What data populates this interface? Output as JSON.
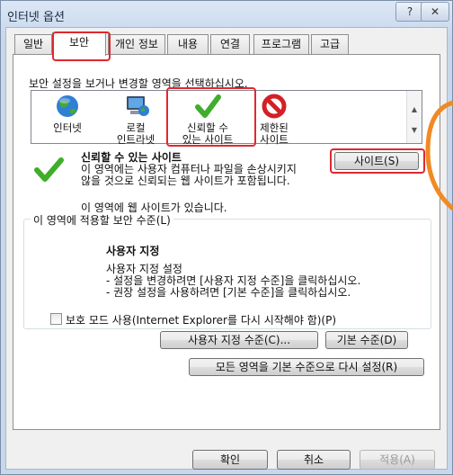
{
  "window": {
    "title": "인터넷 옵션",
    "help_label": "?",
    "close_label": "✕"
  },
  "tabs": [
    "일반",
    "보안",
    "개인 정보",
    "내용",
    "연결",
    "프로그램",
    "고급"
  ],
  "zones": {
    "instruction": "보안 설정을 보거나 변경할 영역을 선택하십시오.",
    "items": [
      {
        "line1": "인터넷",
        "line2": "",
        "icon": "globe-icon"
      },
      {
        "line1": "로컬",
        "line2": "인트라넷",
        "icon": "intranet-icon"
      },
      {
        "line1": "신뢰할 수",
        "line2": "있는 사이트",
        "icon": "check-icon"
      },
      {
        "line1": "제한된",
        "line2": "사이트",
        "icon": "restricted-icon"
      }
    ]
  },
  "zone_info": {
    "title": "신뢰할 수 있는 사이트",
    "description_line1": "이 영역에는 사용자 컴퓨터나 파일을 손상시키지",
    "description_line2": "않을 것으로 신뢰되는 웹 사이트가 포함됩니다.",
    "sites_note": "이 영역에 웹 사이트가 있습니다.",
    "sites_button": "사이트(S)"
  },
  "security_level": {
    "group_label": "이 영역에 적용할 보안 수준(L)",
    "heading": "사용자 지정",
    "line1": "사용자 지정 설정",
    "line2": "- 설정을 변경하려면 [사용자 지정 수준]을 클릭하십시오.",
    "line3": "- 권장 설정을 사용하려면 [기본 수준]을 클릭하십시오.",
    "protected_mode": "보호 모드 사용(Internet Explorer를 다시 시작해야 함)(P)",
    "custom_level_button": "사용자 지정 수준(C)...",
    "default_level_button": "기본 수준(D)",
    "reset_all_button": "모든 영역을 기본 수준으로 다시 설정(R)"
  },
  "footer": {
    "ok": "확인",
    "cancel": "취소",
    "apply": "적용(A)"
  },
  "colors": {
    "highlight": "#e0282e",
    "check_green": "#3fae2a",
    "accent_orange": "#f08a24"
  }
}
